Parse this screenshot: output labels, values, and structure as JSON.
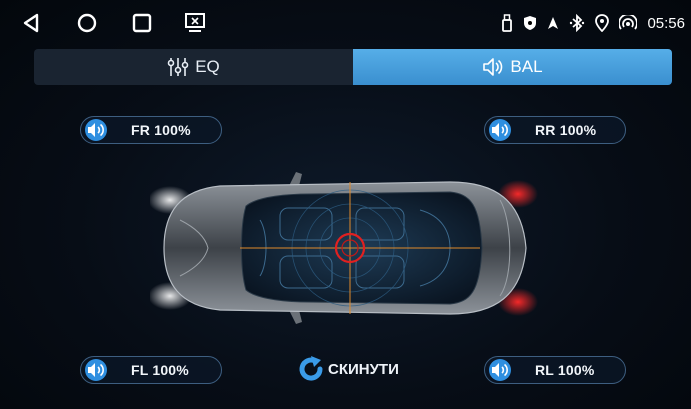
{
  "statusbar": {
    "nav_icons": [
      "back-icon",
      "home-icon",
      "recents-icon",
      "screen-icon"
    ],
    "status_icons": [
      "usb-icon",
      "shield-icon",
      "signal-arrow-icon",
      "bluetooth-icon",
      "location-icon",
      "hotspot-icon"
    ],
    "time": "05:56"
  },
  "tabs": [
    {
      "label": "EQ",
      "icon": "equalizer-sliders-icon",
      "active": false
    },
    {
      "label": "BAL",
      "icon": "speaker-icon",
      "active": true
    }
  ],
  "speakers": {
    "fr": {
      "label": "FR 100%",
      "icon": "speaker-volume-icon"
    },
    "rr": {
      "label": "RR 100%",
      "icon": "speaker-volume-icon"
    },
    "fl": {
      "label": "FL 100%",
      "icon": "speaker-volume-icon"
    },
    "rl": {
      "label": "RL 100%",
      "icon": "speaker-volume-icon"
    }
  },
  "reset": {
    "label": "СКИНУТИ",
    "icon": "refresh-icon"
  },
  "colors": {
    "accent": "#3a8fcf",
    "tab_active": "#56aee8",
    "tab_inactive": "#1a2431",
    "taillight": "#ff2a2a",
    "balance_marker": "#e02020"
  }
}
